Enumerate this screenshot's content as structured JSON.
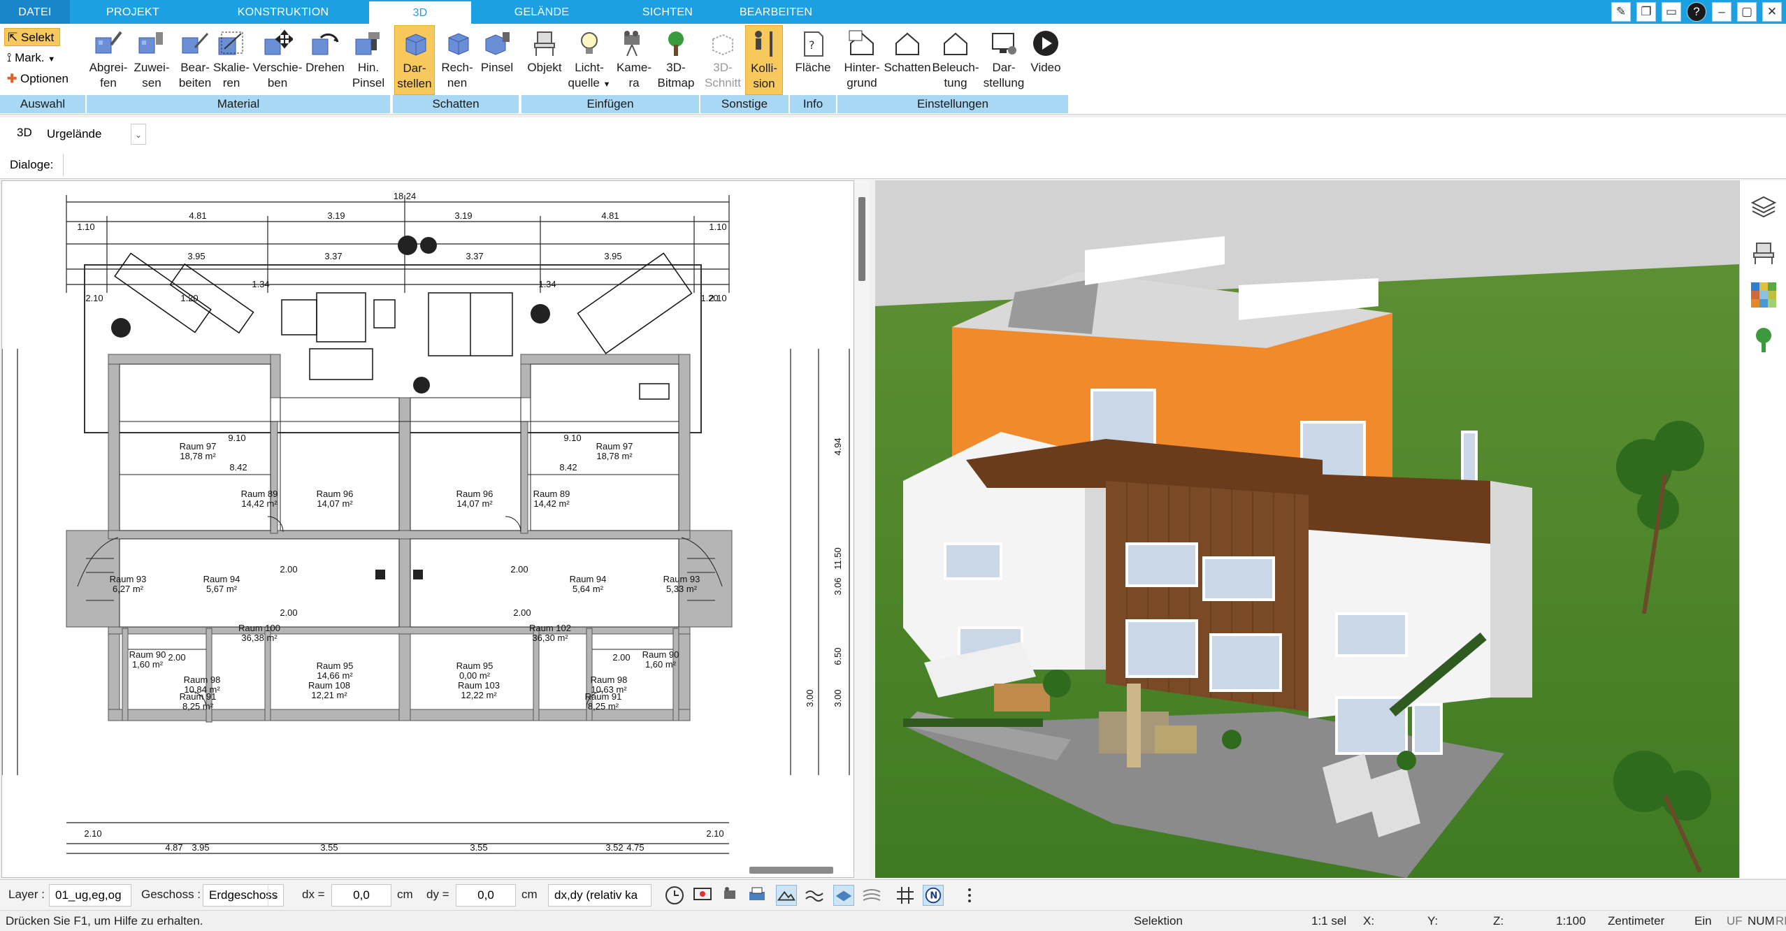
{
  "tabs": [
    {
      "label": "DATEI"
    },
    {
      "label": "PROJEKT"
    },
    {
      "label": "KONSTRUKTION"
    },
    {
      "label": "3D"
    },
    {
      "label": "GELÄNDE"
    },
    {
      "label": "SICHTEN"
    },
    {
      "label": "BEARBEITEN"
    }
  ],
  "auswahl": {
    "selekt": "Selekt",
    "mark": "Mark.",
    "optionen": "Optionen",
    "group": "Auswahl"
  },
  "material": {
    "group": "Material",
    "buttons": [
      {
        "line1": "Abgrei-",
        "line2": "fen"
      },
      {
        "line1": "Zuwei-",
        "line2": "sen"
      },
      {
        "line1": "Bear-",
        "line2": "beiten"
      },
      {
        "line1": "Skalie-",
        "line2": "ren"
      },
      {
        "line1": "Verschie-",
        "line2": "ben"
      },
      {
        "line1": "Drehen",
        "line2": ""
      },
      {
        "line1": "Hin.",
        "line2": "Pinsel"
      }
    ]
  },
  "schatten": {
    "group": "Schatten",
    "buttons": [
      {
        "line1": "Dar-",
        "line2": "stellen"
      },
      {
        "line1": "Rech-",
        "line2": "nen"
      },
      {
        "line1": "Pinsel",
        "line2": ""
      }
    ]
  },
  "einfuegen": {
    "group": "Einfügen",
    "buttons": [
      {
        "line1": "Objekt",
        "line2": ""
      },
      {
        "line1": "Licht-",
        "line2": "quelle"
      },
      {
        "line1": "Kame-",
        "line2": "ra"
      },
      {
        "line1": "3D-",
        "line2": "Bitmap"
      }
    ]
  },
  "sonstige": {
    "group": "Sonstige",
    "buttons": [
      {
        "line1": "3D-",
        "line2": "Schnitt"
      },
      {
        "line1": "Kolli-",
        "line2": "sion"
      }
    ]
  },
  "info": {
    "group": "Info",
    "buttons": [
      {
        "line1": "Fläche",
        "line2": ""
      }
    ]
  },
  "einstellungen": {
    "group": "Einstellungen",
    "buttons": [
      {
        "line1": "Hinter-",
        "line2": "grund"
      },
      {
        "line1": "Schatten",
        "line2": ""
      },
      {
        "line1": "Beleuch-",
        "line2": "tung"
      },
      {
        "line1": "Dar-",
        "line2": "stellung"
      },
      {
        "line1": "Video",
        "line2": ""
      }
    ]
  },
  "viewrow": {
    "label": "3D",
    "terrain": "Urgelände"
  },
  "dialogs": {
    "label": "Dialoge:"
  },
  "plan": {
    "dims_top": [
      "18.24",
      "4.81",
      "3.19",
      "3.19",
      "4.81",
      "1.10",
      "1.10",
      "3.95",
      "3.37",
      "3.37",
      "3.95",
      "1.34",
      "1.34",
      "1.20",
      "1.20",
      "2.10",
      "2.10"
    ],
    "rooms": [
      {
        "name": "Raum 97",
        "area": "18,78 m²"
      },
      {
        "name": "Raum 97",
        "area": "18,78 m²"
      },
      {
        "name": "Raum 89",
        "area": "14,42 m²"
      },
      {
        "name": "Raum 96",
        "area": "14,07 m²"
      },
      {
        "name": "Raum 96",
        "area": "14,07 m²"
      },
      {
        "name": "Raum 89",
        "area": "14,42 m²"
      },
      {
        "name": "Raum 94",
        "area": "5,67 m²"
      },
      {
        "name": "Raum 94",
        "area": "5,64 m²"
      },
      {
        "name": "Raum 93",
        "area": "6,27 m²"
      },
      {
        "name": "Raum 93",
        "area": "5,33 m²"
      },
      {
        "name": "Raum 100",
        "area": "36,38 m²"
      },
      {
        "name": "Raum 102",
        "area": "36,30 m²"
      },
      {
        "name": "Raum 95",
        "area": "14,66 m²"
      },
      {
        "name": "Raum 108",
        "area": "12,21 m²"
      },
      {
        "name": "Raum 95",
        "area": "0,00 m²"
      },
      {
        "name": "Raum 103",
        "area": "12,22 m²"
      },
      {
        "name": "Raum 90",
        "area": "1,60 m²"
      },
      {
        "name": "Raum 90",
        "area": "1,60 m²"
      },
      {
        "name": "Raum 98",
        "area": "10,84 m²"
      },
      {
        "name": "Raum 91",
        "area": "8,25 m²"
      },
      {
        "name": "Raum 98",
        "area": "10,63 m²"
      },
      {
        "name": "Raum 91",
        "area": "8,25 m²"
      }
    ],
    "dims_misc": [
      "9.10",
      "8.42",
      "9.10",
      "8.42",
      "2.00",
      "2.00",
      "2.00",
      "2.00",
      "2.00",
      "2.00",
      "4.94",
      "11.50",
      "3.06",
      "6.50",
      "3.00",
      "3.00",
      "3.55",
      "3.55",
      "3.95",
      "4.87",
      "4.75",
      "3.52",
      "2.10",
      "2.10"
    ]
  },
  "toolrow": {
    "layer_label": "Layer :",
    "layer_value": "01_ug,eg,og",
    "geschoss_label": "Geschoss :",
    "geschoss_value": "Erdgeschoss",
    "dx_label": "dx =",
    "dx_value": "0,0",
    "dx_unit": "cm",
    "dy_label": "dy =",
    "dy_value": "0,0",
    "dy_unit": "cm",
    "mode_value": "dx,dy (relativ ka"
  },
  "status": {
    "help": "Drücken Sie F1, um Hilfe zu erhalten.",
    "mode": "Selektion",
    "sel": "1:1 sel",
    "x": "X:",
    "y": "Y:",
    "z": "Z:",
    "scale": "1:100",
    "unit": "Zentimeter",
    "ein": "Ein",
    "uf": "UF",
    "num": "NUM",
    "rf": "RF"
  },
  "colors": {
    "accent": "#1ba1e2",
    "highlight": "#f7c95c",
    "group": "#a8d8f3",
    "orange": "#f08a2a",
    "grass": "#4f8a2a",
    "wood": "#7a4a26"
  }
}
